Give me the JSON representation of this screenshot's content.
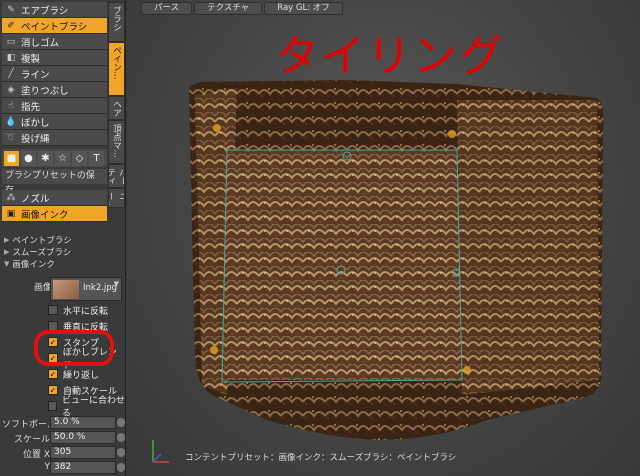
{
  "tools": [
    {
      "label": "エアブラシ",
      "icon": "airbrush-icon",
      "glyph": "✎",
      "selected": false
    },
    {
      "label": "ペイントブラシ",
      "icon": "paintbrush-icon",
      "glyph": "✐",
      "selected": true
    },
    {
      "label": "消しゴム",
      "icon": "eraser-icon",
      "glyph": "▭",
      "selected": false
    },
    {
      "label": "複製",
      "icon": "clone-icon",
      "glyph": "◧",
      "selected": false
    },
    {
      "label": "ライン",
      "icon": "line-icon",
      "glyph": "╱",
      "selected": false
    },
    {
      "label": "塗りつぶし",
      "icon": "fill-icon",
      "glyph": "◈",
      "selected": false
    },
    {
      "label": "指先",
      "icon": "smudge-icon",
      "glyph": "☝",
      "selected": false
    },
    {
      "label": "ぼかし",
      "icon": "blur-icon",
      "glyph": "💧",
      "selected": false
    },
    {
      "label": "投げ縄",
      "icon": "lasso-icon",
      "glyph": "➰",
      "selected": false
    }
  ],
  "side_tabs": [
    {
      "label": "ブラシ",
      "selected": false
    },
    {
      "label": "ペイン...",
      "selected": true
    },
    {
      "label": "ヘア",
      "selected": false
    },
    {
      "label": "頂点マ...",
      "selected": false
    },
    {
      "label": "パーティ",
      "selected": false
    },
    {
      "label": "ユー...",
      "selected": false
    }
  ],
  "shapes": [
    {
      "icon": "square-shape-icon",
      "glyph": "■",
      "selected": true
    },
    {
      "icon": "circle-shape-icon",
      "glyph": "●",
      "selected": false
    },
    {
      "icon": "splat-shape-icon",
      "glyph": "✱",
      "selected": false
    },
    {
      "icon": "star-shape-icon",
      "glyph": "☆",
      "selected": false
    },
    {
      "icon": "sticker-shape-icon",
      "glyph": "◇",
      "selected": false
    },
    {
      "icon": "text-shape-icon",
      "glyph": "T",
      "selected": false
    }
  ],
  "preset_button": "ブラシプリセットの保存...",
  "nozzles": [
    {
      "label": "ノズル",
      "icon": "nozzle-icon",
      "glyph": "⁂",
      "selected": false
    },
    {
      "label": "画像インク",
      "icon": "image-ink-icon",
      "glyph": "▣",
      "selected": true
    }
  ],
  "sections": [
    "ペイントブラシ",
    "スムーズブラシ",
    "画像インク"
  ],
  "image": {
    "label": "画像",
    "file": "Ink2.jpg"
  },
  "options": [
    {
      "label": "水平に反転",
      "checked": false
    },
    {
      "label": "垂直に反転",
      "checked": false
    },
    {
      "label": "スタンプ",
      "checked": true
    },
    {
      "label": "ぼかしブレンド",
      "checked": true
    },
    {
      "label": "繰り返し",
      "checked": true
    },
    {
      "label": "自動スケール",
      "checked": true
    },
    {
      "label": "ビューに合わせる",
      "checked": false
    }
  ],
  "values": [
    {
      "label": "ソフトボー...",
      "value": "5.0 %"
    },
    {
      "label": "スケール",
      "value": "50.0 %"
    },
    {
      "label": "位置 X",
      "value": "305"
    },
    {
      "label": "Y",
      "value": "382"
    }
  ],
  "viewport": {
    "tabs": [
      "パース",
      "テクスチャ",
      "Ray GL: オフ"
    ],
    "annotation": "タイリング",
    "footer": "コンテントプリセット：画像インク：スムーズブラシ：ペイントブラシ"
  },
  "colors": {
    "accent": "#f0a526",
    "annotation": "#e40000",
    "panel": "#3a3a3a"
  }
}
